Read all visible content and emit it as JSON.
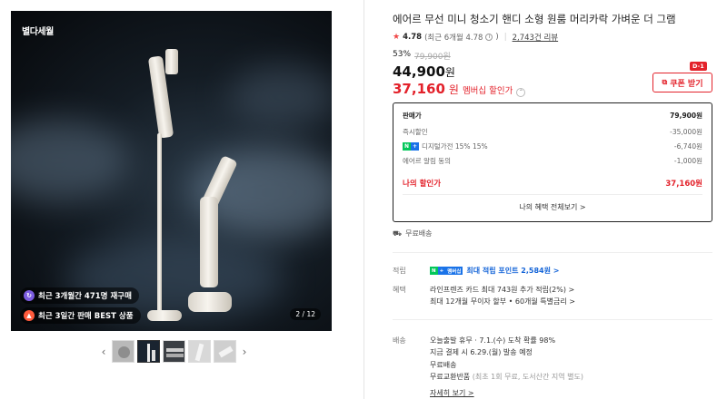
{
  "gallery": {
    "brand_logo": "별다세월",
    "badges": [
      {
        "text": "최근 3개월간 471명 재구매",
        "icon": "repeat-icon",
        "color": "#7b5ce0"
      },
      {
        "text": "최근 3일간 판매 BEST 상품",
        "icon": "fire-icon",
        "color": "#ff5a3c"
      }
    ],
    "counter": "2 / 12",
    "thumbnail_count": 5,
    "prev_icon": "chevron-left-icon",
    "next_icon": "chevron-right-icon"
  },
  "product": {
    "title": "에어르 무선 미니 청소기 핸디 소형 원룸 머리카락 가벼운 더 그램",
    "rating": {
      "score": "4.78",
      "recent": "(최근 6개월 4.78",
      "recent_end": ")",
      "reviews": "2,743건 리뷰"
    },
    "discount_rate": "53%",
    "original_price": "79,900원",
    "price": "44,900",
    "price_unit": "원",
    "member_price": "37,160",
    "member_unit": "원",
    "member_label": "멤버십 할인가",
    "coupon": {
      "label": "쿠폰 받기",
      "dday": "D-1",
      "color": "#e3222b"
    }
  },
  "price_box": {
    "rows": [
      {
        "label": "판매가",
        "value": "79,900원"
      },
      {
        "label": "즉시할인",
        "value": "-35,000원"
      },
      {
        "label": "디지털가전 15% 15%",
        "value": "-6,740원"
      },
      {
        "label": "에어르 알림 동의",
        "value": "-1,000원"
      }
    ],
    "final_label": "나의 할인가",
    "final_value": "37,160원",
    "all_benefits": "나의 혜택 전체보기 >"
  },
  "shipping_free": "무료배송",
  "points": {
    "label": "적립",
    "tag": "멤버십",
    "text": "최대 적립 포인트 2,584원 >"
  },
  "benefits": {
    "label": "혜택",
    "line1": "라인프렌즈 카드 최대 743원 추가 적립(2%) >",
    "line2": "최대 12개월 무이자 할부 • 60개월 특별금리 >"
  },
  "delivery": {
    "label": "배송",
    "line1": "오늘출발 휴무 · 7.1.(수) 도착 확률 98%",
    "line2": "지금 결제 시 6.29.(월) 발송 예정",
    "line3": "무료배송",
    "line4": "무료교환반품",
    "line4_sub": "(최초 1회 무료, 도서산간 지역 별도)",
    "more": "자세히 보기 >"
  },
  "colors": {
    "accent_red": "#e3222b",
    "point_blue": "#1565d8",
    "naver_green": "#03c75a"
  }
}
